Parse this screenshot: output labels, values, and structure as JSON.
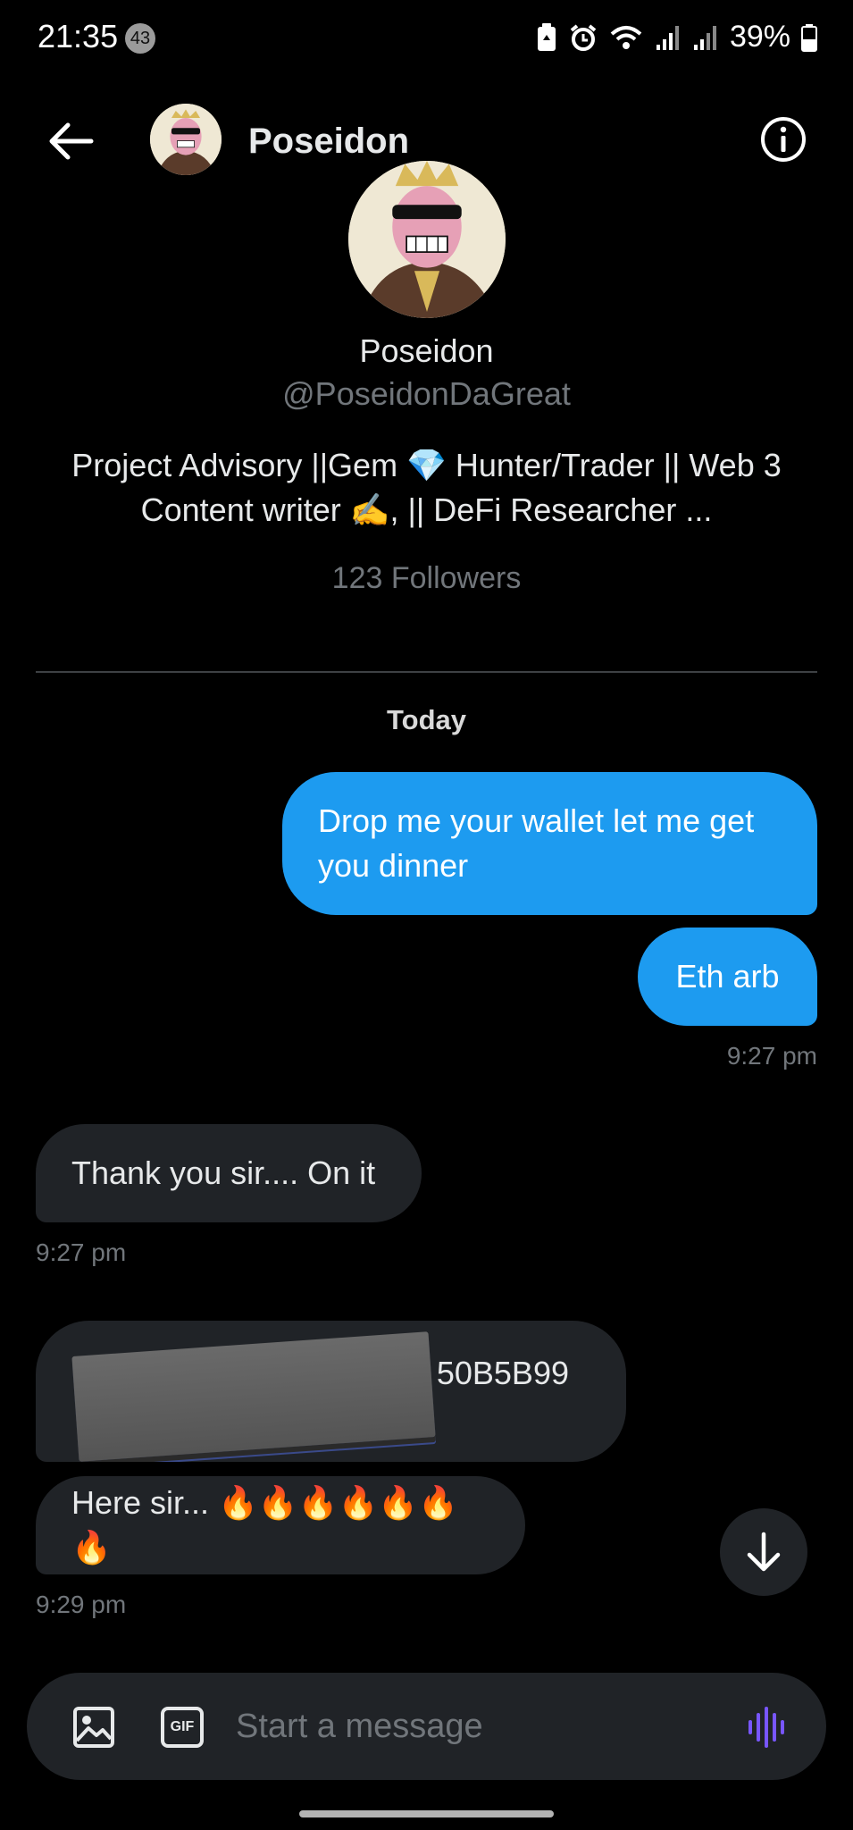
{
  "status_bar": {
    "time": "21:35",
    "notification_count": "43",
    "battery": "39%"
  },
  "header": {
    "name": "Poseidon"
  },
  "profile": {
    "name": "Poseidon",
    "handle": "@PoseidonDaGreat",
    "bio": "Project Advisory ||Gem 💎 Hunter/Trader || Web 3 Content writer ✍️, || DeFi Researcher ...",
    "followers": "123 Followers"
  },
  "conversation": {
    "date_label": "Today",
    "messages": [
      {
        "direction": "sent",
        "text": "Drop me your wallet let me get you dinner"
      },
      {
        "direction": "sent",
        "text": "Eth arb",
        "time": "9:27 pm"
      },
      {
        "direction": "received",
        "text": "Thank you sir.... On it",
        "time": "9:27 pm"
      },
      {
        "direction": "received",
        "text": "50B5B99"
      },
      {
        "direction": "received",
        "text": "Here sir... 🔥🔥🔥🔥🔥🔥🔥",
        "time": "9:29 pm"
      }
    ]
  },
  "composer": {
    "placeholder": "Start a message",
    "gif_label": "GIF"
  },
  "colors": {
    "accent": "#1d9bf0",
    "received_bubble": "#202327",
    "voice_icon": "#7856ff"
  }
}
